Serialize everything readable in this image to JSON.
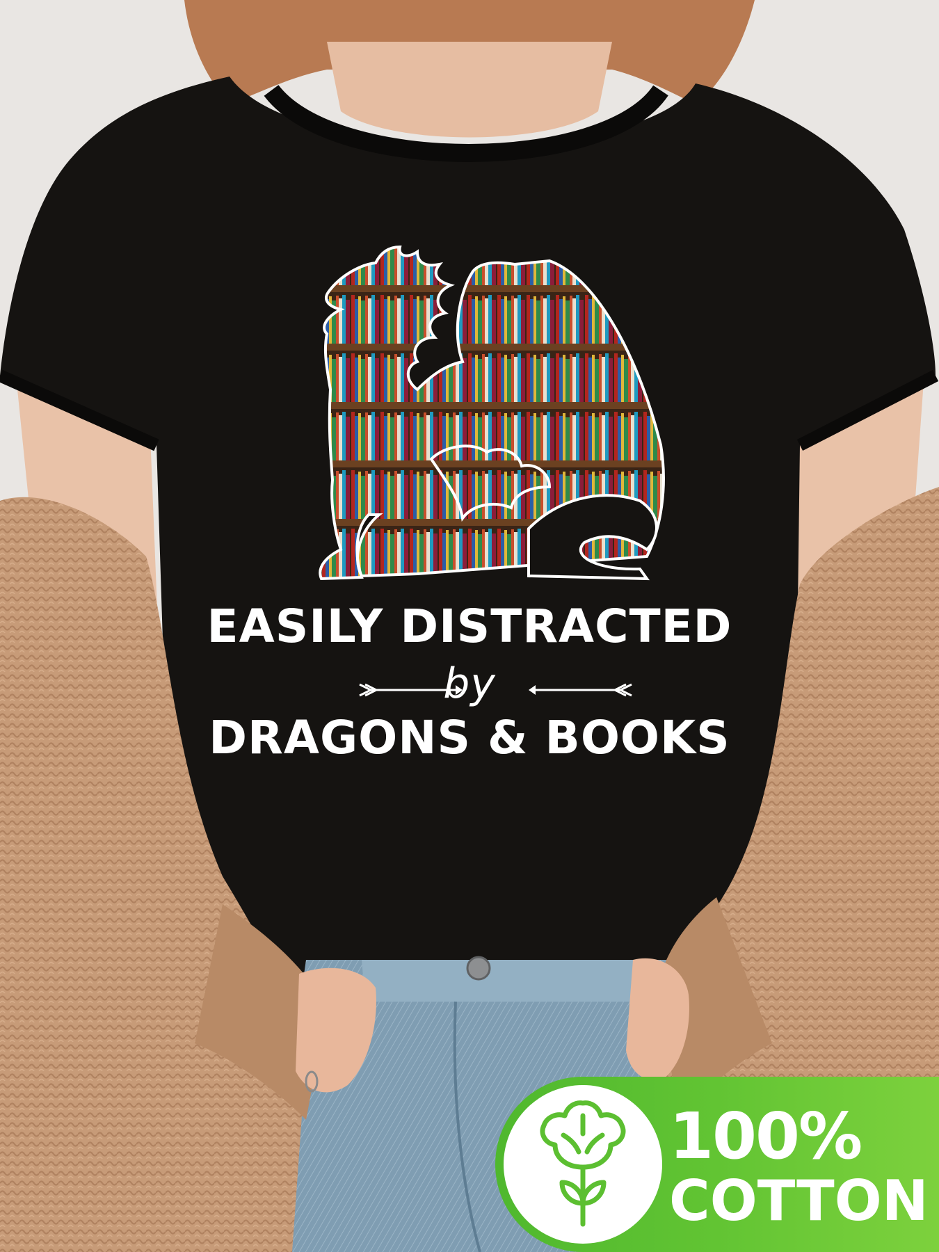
{
  "print": {
    "line1": "EASILY DISTRACTED",
    "line2": "by",
    "line3": "DRAGONS & BOOKS"
  },
  "badge": {
    "percent": "100%",
    "material": "COTTON",
    "icon": "cotton-plant-icon",
    "color": "#5cbf31"
  },
  "colors": {
    "shirt": "#141210",
    "cardigan": "#c59a78",
    "jeans": "#7f9cb0",
    "hair": "#b87a52",
    "skin": "#e9c2a8",
    "background": "#e9e6e3"
  },
  "graphic": {
    "icon": "dragon-bookshelf-icon"
  }
}
